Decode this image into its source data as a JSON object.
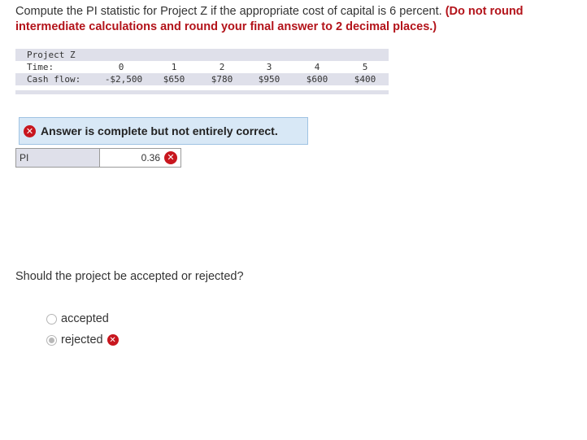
{
  "question": {
    "text": "Compute the PI statistic for Project Z if the appropriate cost of capital is 6 percent. ",
    "emphasis": "(Do not round intermediate calculations and round your final answer to 2 decimal places.)"
  },
  "cash_flow_table": {
    "title": "Project Z",
    "time_label": "Time:",
    "cash_flow_label": "Cash flow:",
    "times": [
      "0",
      "1",
      "2",
      "3",
      "4",
      "5"
    ],
    "cash_flows": [
      "-$2,500",
      "$650",
      "$780",
      "$950",
      "$600",
      "$400"
    ]
  },
  "feedback": {
    "icon": "x-circle-icon",
    "text": "Answer is complete but not entirely correct."
  },
  "answer": {
    "label": "PI",
    "value": "0.36",
    "status_icon": "x-circle-icon"
  },
  "question2": {
    "text": "Should the project be accepted or rejected?"
  },
  "options": [
    {
      "label": "accepted",
      "selected": false
    },
    {
      "label": "rejected",
      "selected": true,
      "status_icon": "x-circle-icon"
    }
  ],
  "colors": {
    "emphasis": "#b3131a",
    "error": "#c8161e",
    "feedback_bg": "#d8e8f6",
    "table_shade": "#dfe0ea"
  }
}
